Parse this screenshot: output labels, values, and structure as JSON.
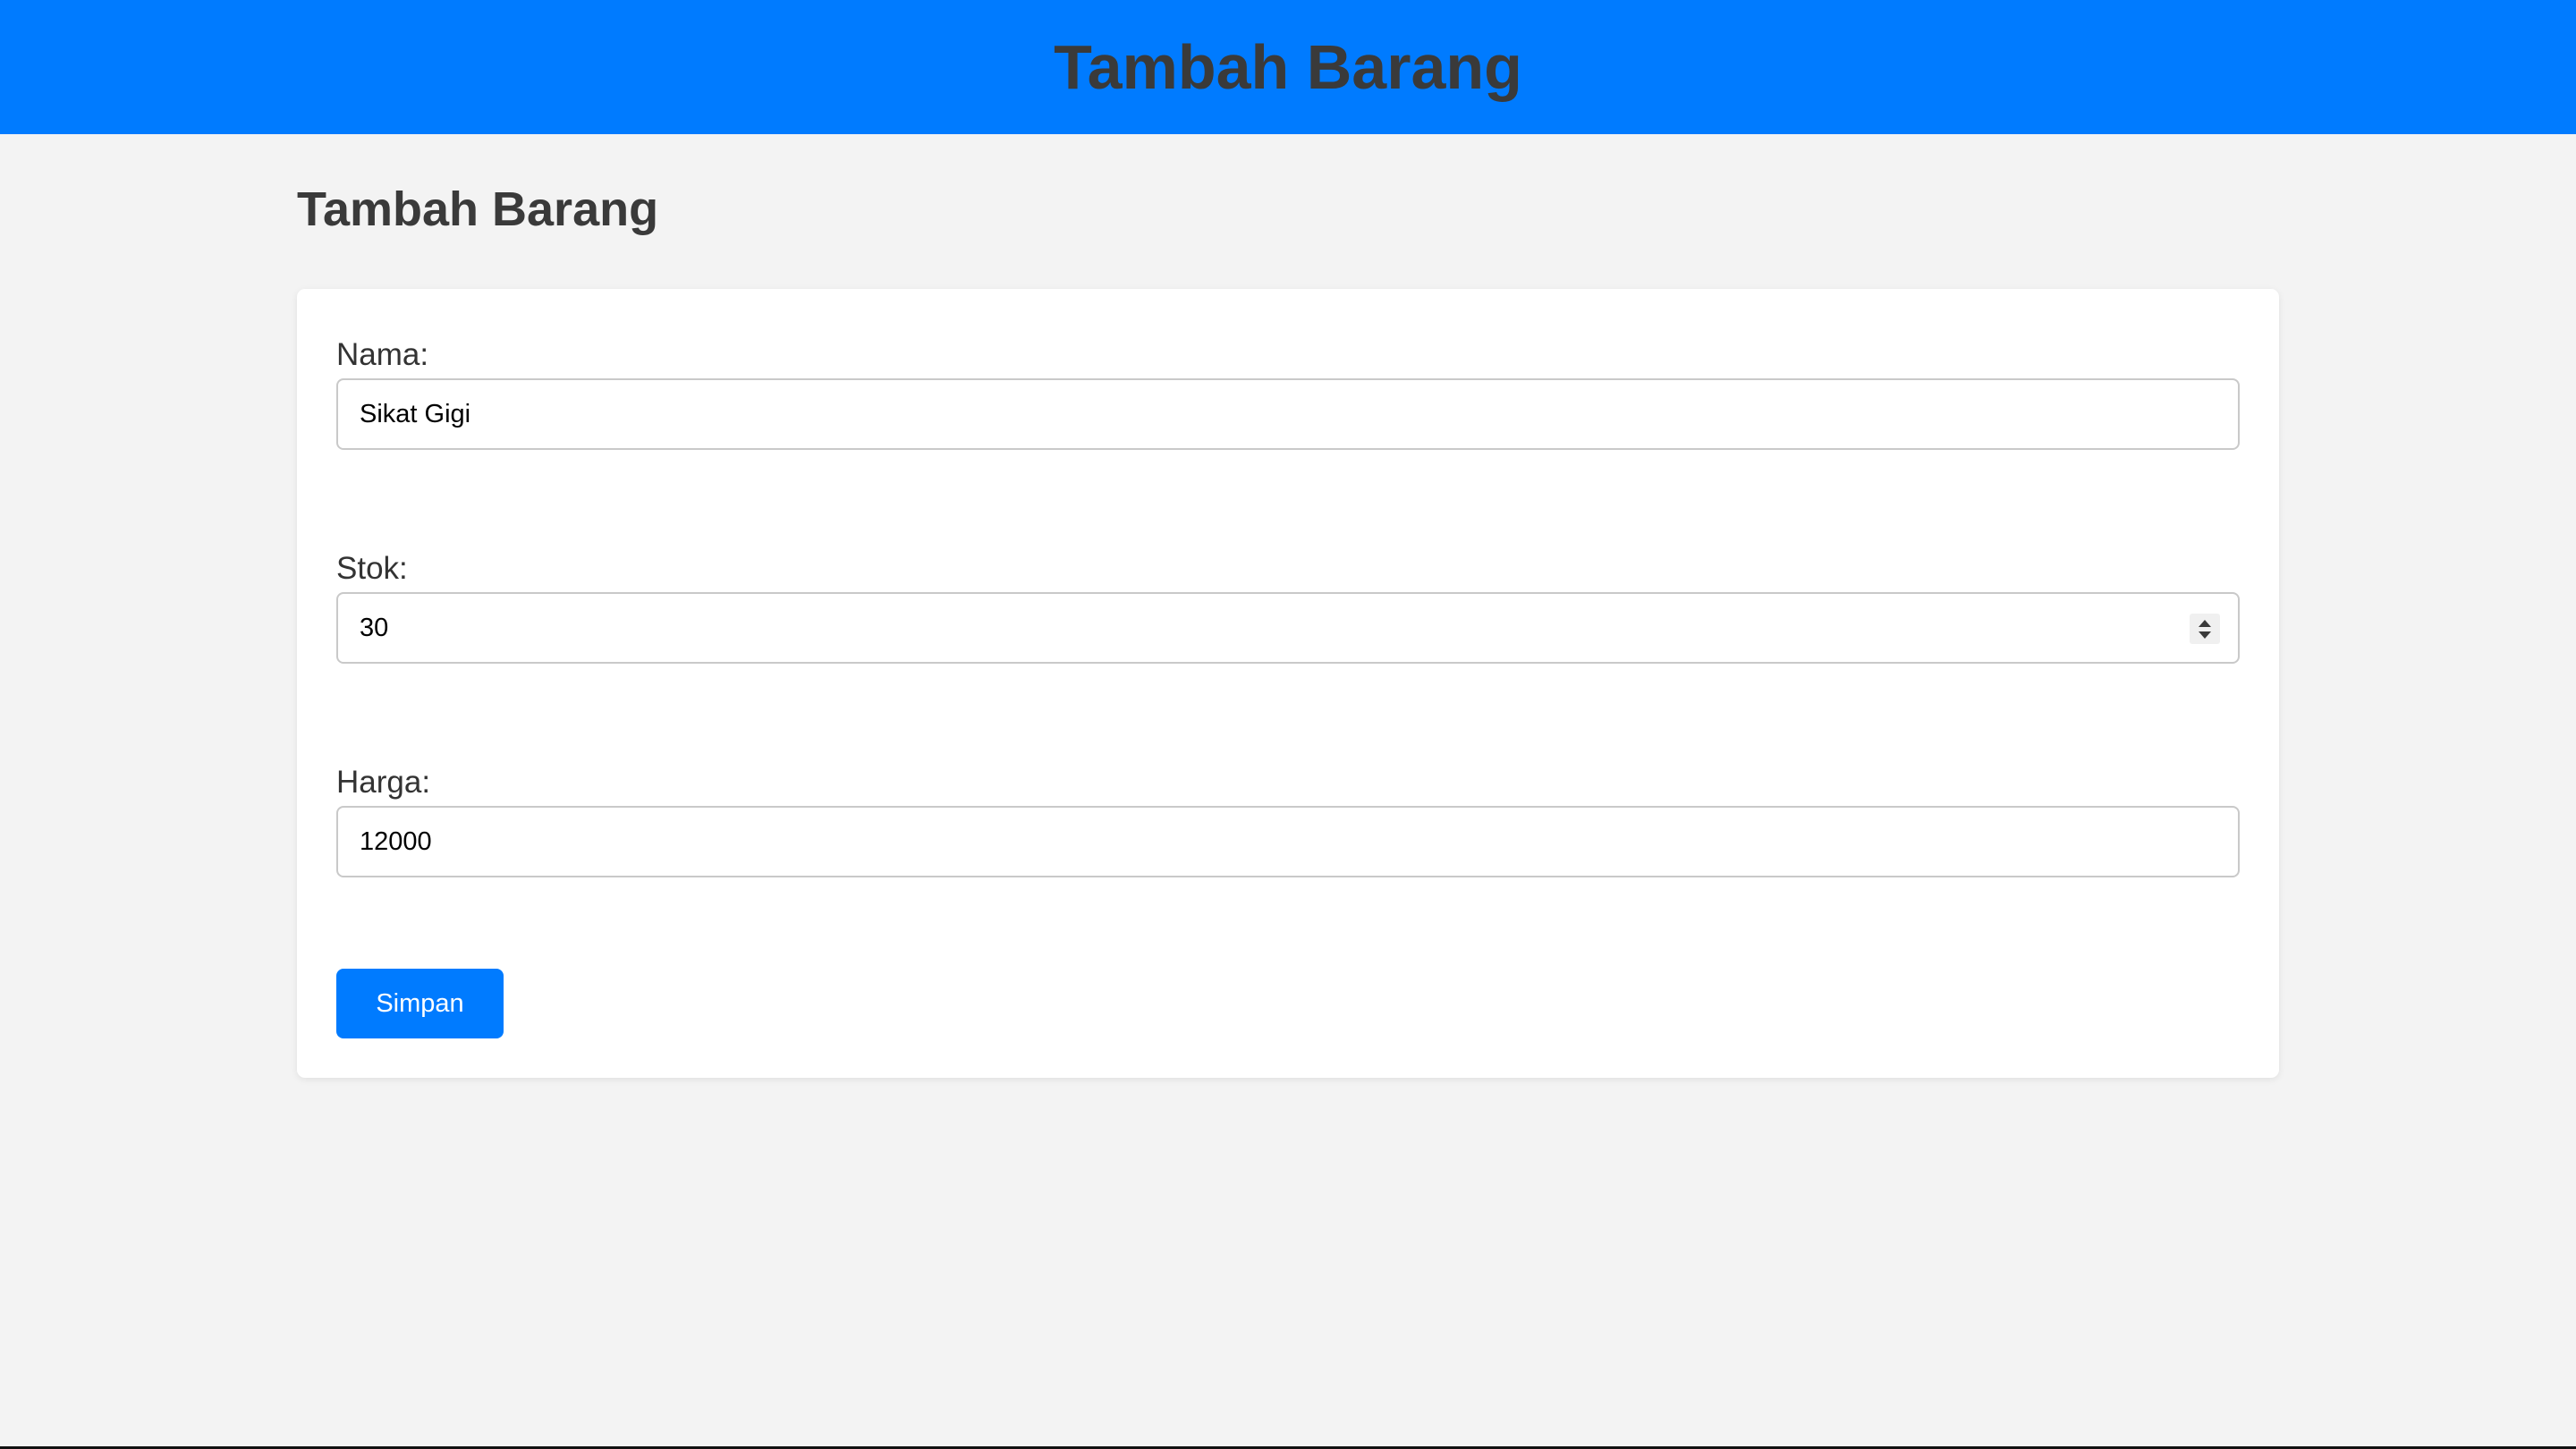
{
  "header": {
    "title": "Tambah Barang"
  },
  "main": {
    "heading": "Tambah Barang"
  },
  "form": {
    "nama": {
      "label": "Nama:",
      "value": "Sikat Gigi"
    },
    "stok": {
      "label": "Stok:",
      "value": "30"
    },
    "harga": {
      "label": "Harga:",
      "value": "12000"
    },
    "submit_label": "Simpan"
  },
  "colors": {
    "accent": "#007bff",
    "background": "#f3f3f3",
    "card": "#ffffff",
    "heading_text": "#3a3a3a"
  },
  "icons": {
    "stok_spinner": "number-spinner-icon"
  }
}
